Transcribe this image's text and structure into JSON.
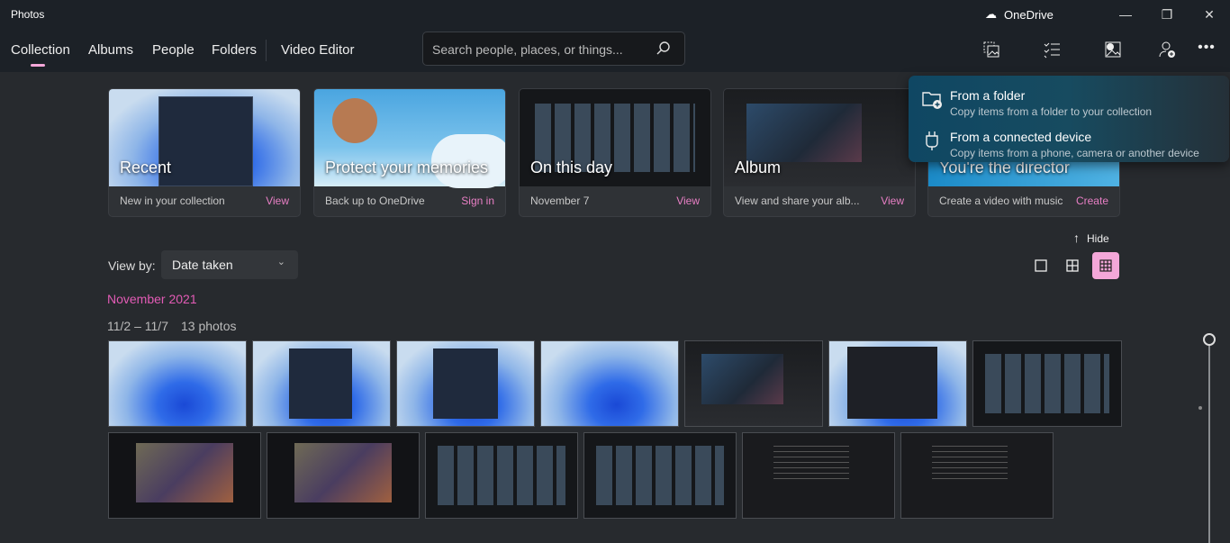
{
  "app": {
    "title": "Photos",
    "onedrive": "OneDrive"
  },
  "nav": [
    {
      "label": "Collection"
    },
    {
      "label": "Albums"
    },
    {
      "label": "People"
    },
    {
      "label": "Folders"
    },
    {
      "label": "Video Editor"
    }
  ],
  "search": {
    "placeholder": "Search people, places, or things..."
  },
  "accent": "#f4a7d9",
  "cards": [
    {
      "title": "Recent",
      "subtitle": "New in your collection",
      "action": "View"
    },
    {
      "title": "Protect your memories",
      "subtitle": "Back up to OneDrive",
      "action": "Sign in"
    },
    {
      "title": "On this day",
      "subtitle": "November 7",
      "action": "View"
    },
    {
      "title": "Album",
      "subtitle": "View and share your alb...",
      "action": "View"
    },
    {
      "title": "You're the director",
      "subtitle": "Create a video with music",
      "action": "Create"
    }
  ],
  "import_menu": [
    {
      "title": "From a folder",
      "subtitle": "Copy items from a folder to your collection"
    },
    {
      "title": "From a connected device",
      "subtitle": "Copy items from a phone, camera or another device"
    }
  ],
  "view": {
    "label": "View by:",
    "selected": "Date taken",
    "hide": "Hide"
  },
  "group": {
    "month": "November 2021",
    "range": "11/2 – 11/7",
    "count": "13 photos"
  }
}
